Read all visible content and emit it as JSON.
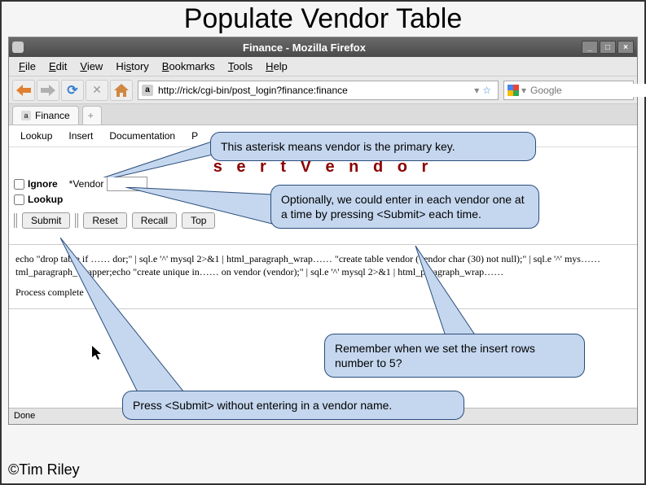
{
  "slide": {
    "title": "Populate Vendor Table",
    "copyright": "©Tim Riley"
  },
  "window": {
    "title": "Finance - Mozilla Firefox",
    "menu": {
      "file": "File",
      "edit": "Edit",
      "view": "View",
      "history": "History",
      "bookmarks": "Bookmarks",
      "tools": "Tools",
      "help": "Help"
    },
    "url": "http://rick/cgi-bin/post_login?finance:finance",
    "search_placeholder": "Google",
    "tab_label": "Finance",
    "status": "Done"
  },
  "app": {
    "menu": {
      "lookup": "Lookup",
      "insert": "Insert",
      "documentation": "Documentation",
      "next_initial": "P"
    },
    "heading_visible": "s e r t   V e n d o r",
    "ignore_label": "Ignore",
    "vendor_label": "*Vendor",
    "lookup_label": "Lookup",
    "buttons": {
      "submit": "Submit",
      "reset": "Reset",
      "recall": "Recall",
      "top": "Top"
    },
    "echo": "echo \"drop table if …… dor;\" | sql.e '^' mysql 2>&1 | html_paragraph_wrap…… \"create table vendor (vendor char (30) not null);\" | sql.e '^' mys…… tml_paragraph_wrapper;echo \"create unique in…… on vendor (vendor);\" | sql.e '^' mysql 2>&1 | html_paragraph_wrap……",
    "complete": "Process complete"
  },
  "callouts": {
    "c1": "This asterisk means vendor is the primary key.",
    "c2": "Optionally, we could enter in each vendor one at a time by pressing <Submit> each time.",
    "c3": "Remember when we set the insert rows number to 5?",
    "c4": "Press <Submit> without entering in a vendor name."
  }
}
